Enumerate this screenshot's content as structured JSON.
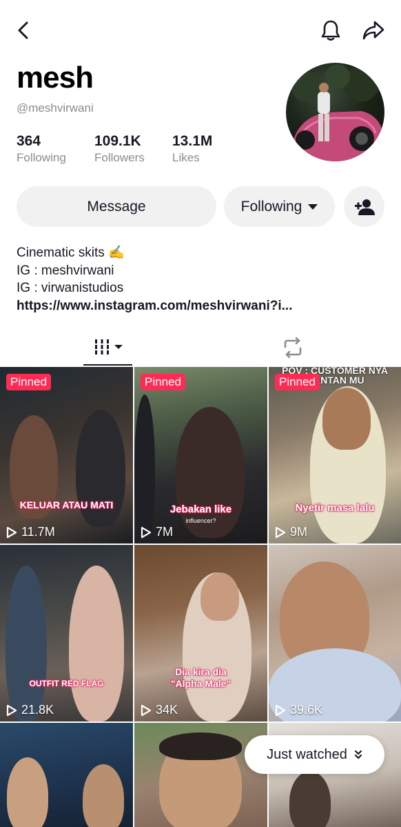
{
  "profile": {
    "display_name": "mesh",
    "username": "@meshvirwani"
  },
  "stats": [
    {
      "value": "364",
      "label": "Following"
    },
    {
      "value": "109.1K",
      "label": "Followers"
    },
    {
      "value": "13.1M",
      "label": "Likes"
    }
  ],
  "actions": {
    "message_label": "Message",
    "following_label": "Following"
  },
  "bio": {
    "lines": [
      "Cinematic skits ✍️",
      "IG : meshvirwani",
      "IG : virwanistudios"
    ],
    "link": "https://www.instagram.com/meshvirwani?i..."
  },
  "videos": [
    {
      "pinned": "Pinned",
      "views": "11.7M",
      "caption": "KELUAR ATAU MATI"
    },
    {
      "pinned": "Pinned",
      "views": "7M",
      "caption": "Jebakan like",
      "subcaption": "influencer?"
    },
    {
      "pinned": "Pinned",
      "views": "9M",
      "caption": "Nyetir masa lalu",
      "top_text": "POV : CUSTOMER NYA\nMANTAN MU"
    },
    {
      "views": "21.8K",
      "caption": "OUTFIT RED FLAG"
    },
    {
      "views": "34K",
      "caption": "Dia kira dia\n\"Alpha Male\""
    },
    {
      "views": "39.6K"
    }
  ],
  "just_watched_label": "Just watched",
  "colors": {
    "accent": "#fe2c55",
    "text_primary": "#161823",
    "text_secondary": "#8a8b91",
    "button_bg": "#f1f1f2"
  },
  "icons": [
    "back-arrow-icon",
    "bell-icon",
    "share-icon",
    "add-friend-icon",
    "grid-icon",
    "repost-icon",
    "play-icon",
    "double-chevron-down-icon"
  ]
}
